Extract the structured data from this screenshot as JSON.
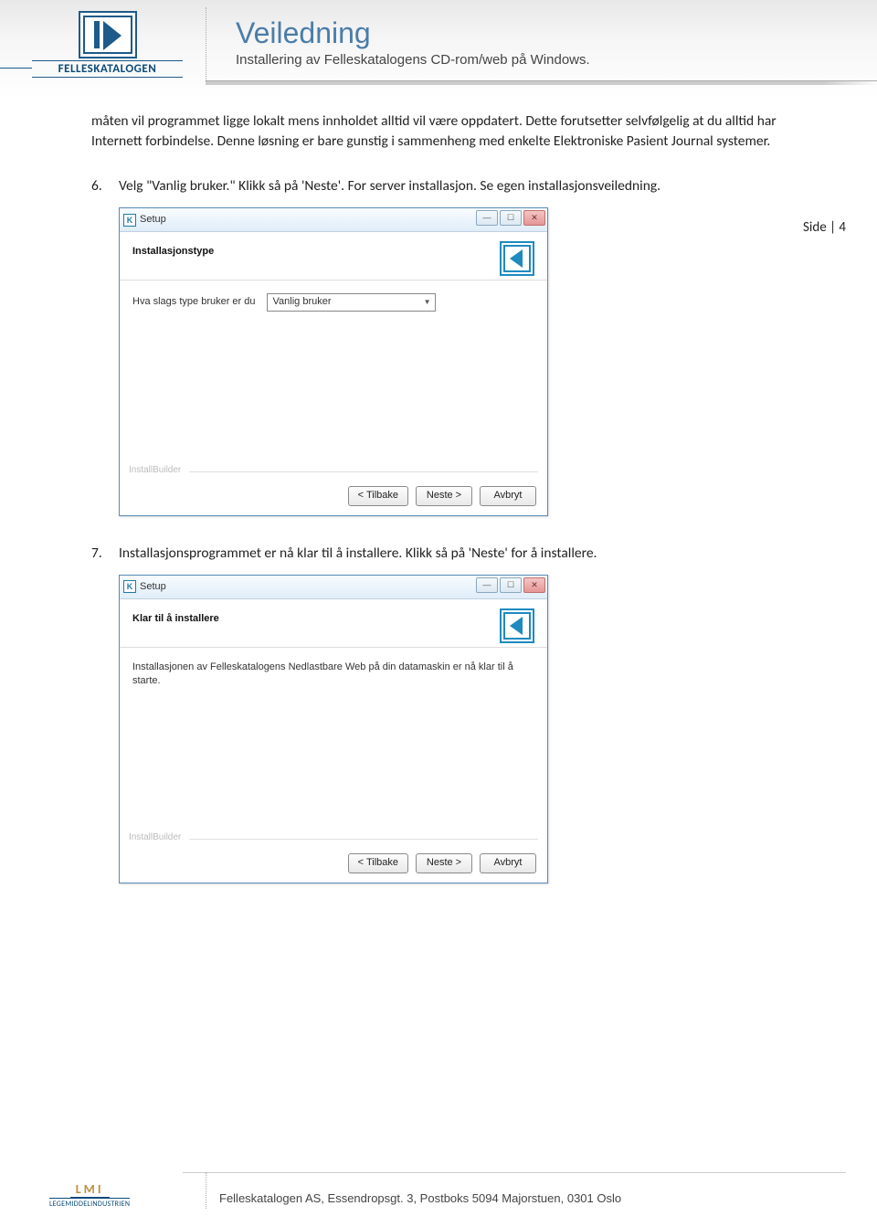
{
  "header": {
    "logo_text": "FELLESKATALOGEN",
    "title": "Veiledning",
    "subtitle": "Installering av Felleskatalogens CD-rom/web på Windows."
  },
  "side_label": "Side | 4",
  "intro_para": "måten vil programmet ligge lokalt mens innholdet alltid vil være oppdatert. Dette forutsetter selvfølgelig at du alltid har Internett forbindelse. Denne løsning er bare gunstig i sammenheng med enkelte Elektroniske Pasient Journal systemer.",
  "steps": [
    {
      "num": "6.",
      "text": "Velg \"Vanlig bruker.\" Klikk så på 'Neste'. For server installasjon. Se egen installasjonsveiledning."
    },
    {
      "num": "7.",
      "text": "Installasjonsprogrammet er nå klar til å installere. Klikk så på 'Neste' for å installere."
    }
  ],
  "dialog1": {
    "window_title": "Setup",
    "head_title": "Installasjonstype",
    "field_label": "Hva slags type bruker er du",
    "dropdown_value": "Vanlig bruker",
    "ib_label": "InstallBuilder",
    "btn_back": "< Tilbake",
    "btn_next": "Neste >",
    "btn_cancel": "Avbryt"
  },
  "dialog2": {
    "window_title": "Setup",
    "head_title": "Klar til å installere",
    "body_text": "Installasjonen av Felleskatalogens Nedlastbare Web på din datamaskin er nå klar til å starte.",
    "ib_label": "InstallBuilder",
    "btn_back": "< Tilbake",
    "btn_next": "Neste >",
    "btn_cancel": "Avbryt"
  },
  "footer": {
    "lmi": "LMI",
    "lmi_sub": "LEGEMIDDELINDUSTRIEN",
    "text": "Felleskatalogen AS, Essendropsgt. 3, Postboks 5094 Majorstuen, 0301 Oslo"
  }
}
